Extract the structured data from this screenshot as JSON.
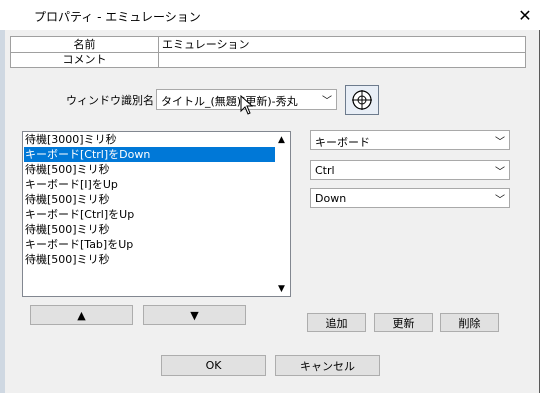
{
  "window": {
    "title": "プロパティ - エミュレーション",
    "close_glyph": "✕"
  },
  "table": {
    "rows": [
      {
        "label": "名前",
        "value": "エミュレーション"
      },
      {
        "label": "コメント",
        "value": ""
      }
    ]
  },
  "window_id": {
    "label": "ウィンドウ識別名",
    "value": "タイトル_(無題)(更新)-秀丸",
    "chevron": "﹀"
  },
  "action_list": {
    "items": [
      "待機[3000]ミリ秒",
      "キーボード[Ctrl]をDown",
      "待機[500]ミリ秒",
      "キーボード[I]をUp",
      "待機[500]ミリ秒",
      "キーボード[Ctrl]をUp",
      "待機[500]ミリ秒",
      "キーボード[Tab]をUp",
      "待機[500]ミリ秒"
    ],
    "selected_index": 1,
    "scroll_up": "▲",
    "scroll_down": "▼"
  },
  "move": {
    "up_label": "▲",
    "down_label": "▼"
  },
  "params": {
    "type": "キーボード",
    "key": "Ctrl",
    "state": "Down",
    "chevron": "﹀"
  },
  "actions": {
    "add": "追加",
    "update": "更新",
    "delete": "削除"
  },
  "dialog": {
    "ok": "OK",
    "cancel": "キャンセル"
  },
  "colors": {
    "selection": "#0078d7",
    "background": "#f0f0f0"
  }
}
